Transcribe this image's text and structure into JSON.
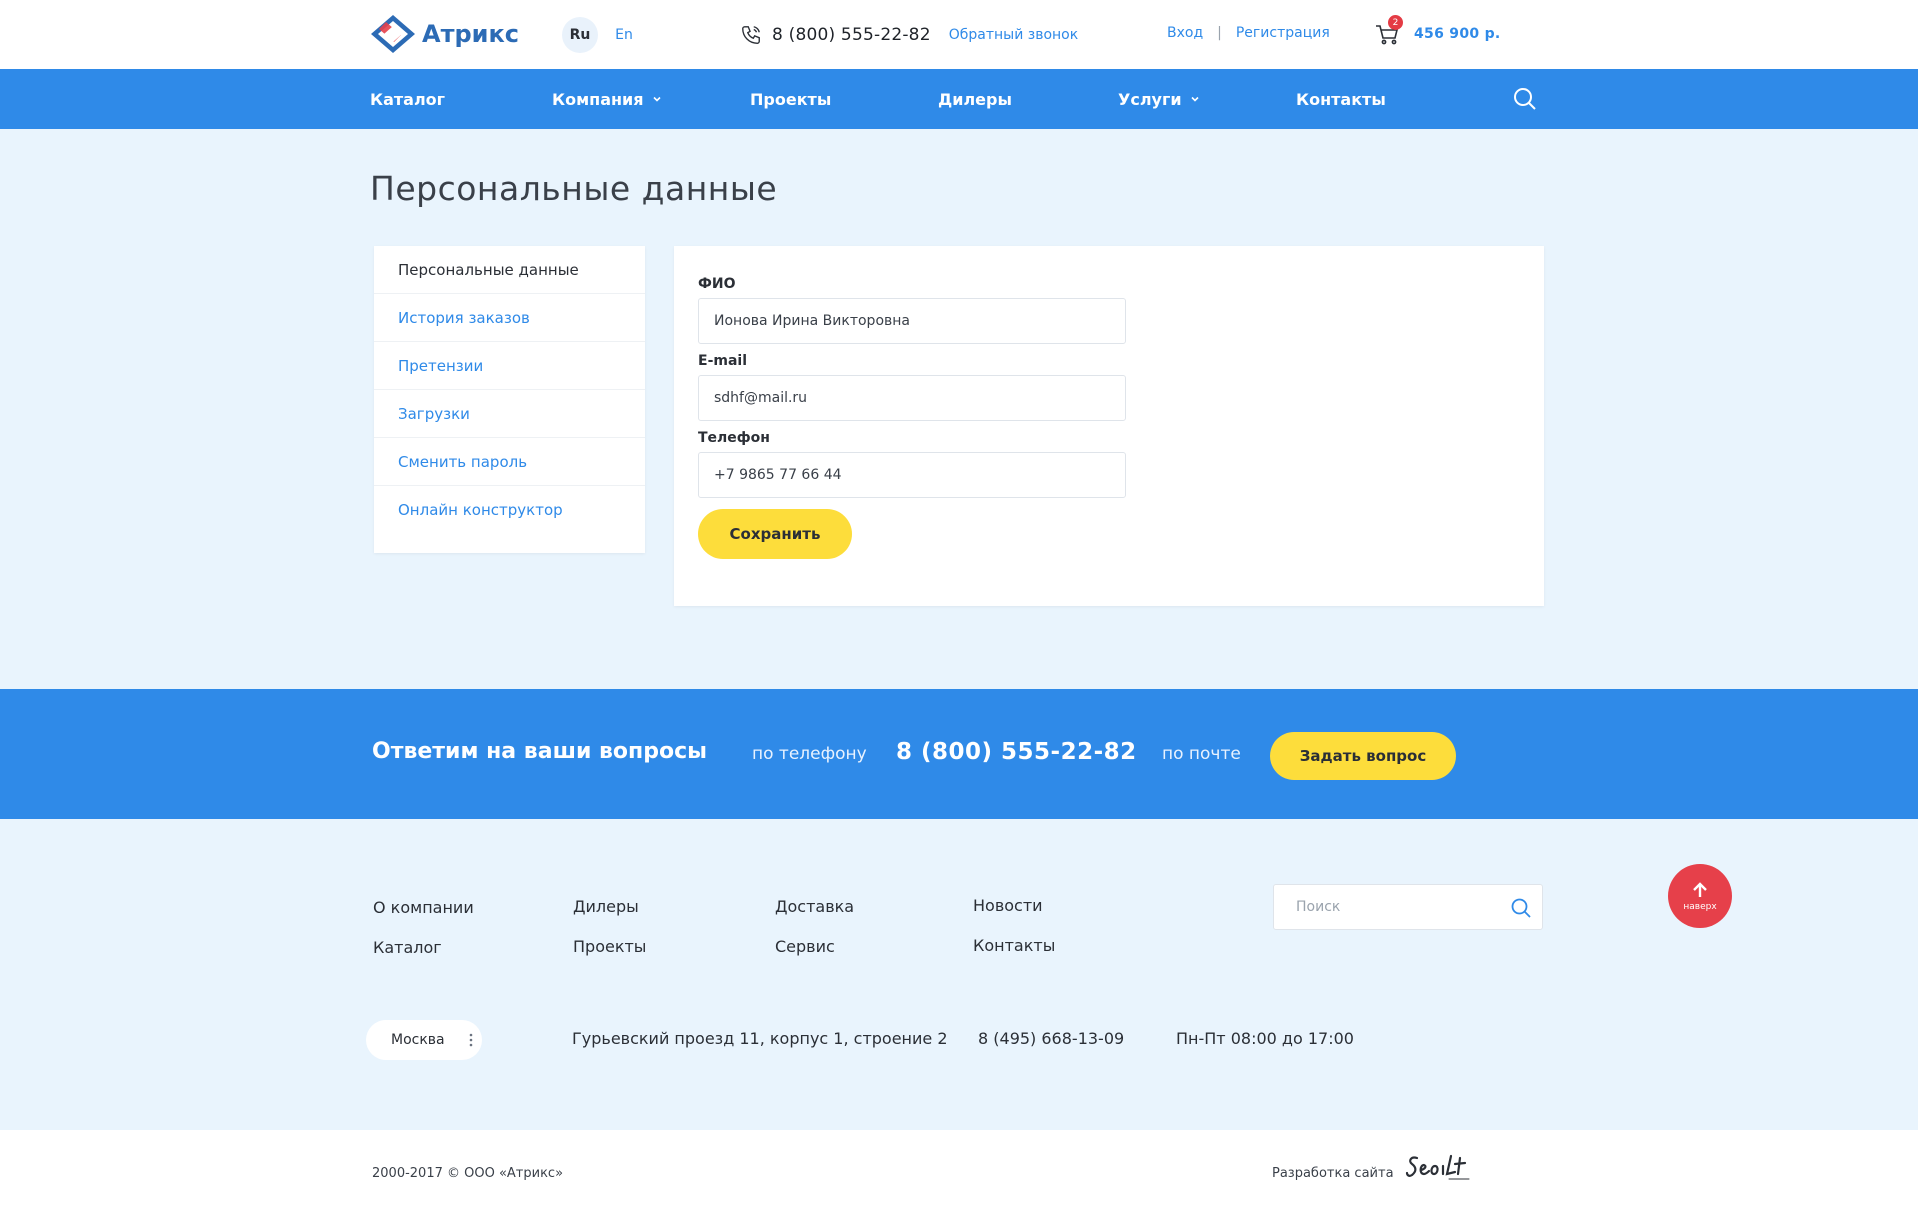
{
  "header": {
    "logo_text": "Атрикс",
    "lang_ru": "Ru",
    "lang_en": "En",
    "phone": "8 (800) 555-22-82",
    "callback": "Обратный звонок",
    "login": "Вход",
    "auth_separator": "|",
    "register": "Регистрация",
    "cart_count": "2",
    "cart_sum": "456 900 р."
  },
  "nav": {
    "items": [
      {
        "label": "Каталог"
      },
      {
        "label": "Компания"
      },
      {
        "label": "Проекты"
      },
      {
        "label": "Дилеры"
      },
      {
        "label": "Услуги"
      },
      {
        "label": "Контакты"
      }
    ]
  },
  "page": {
    "title": "Персональные данные"
  },
  "sidebar": {
    "items": [
      {
        "label": "Персональные данные"
      },
      {
        "label": "История заказов"
      },
      {
        "label": "Претензии"
      },
      {
        "label": "Загрузки"
      },
      {
        "label": "Сменить пароль"
      },
      {
        "label": "Онлайн конструктор"
      }
    ]
  },
  "form": {
    "fio_label": "ФИО",
    "fio_value": "Ионова Ирина Викторовна",
    "email_label": "E-mail",
    "email_value": "sdhf@mail.ru",
    "phone_label": "Телефон",
    "phone_value": "+7 9865 77 66 44",
    "save_label": "Сохранить"
  },
  "questions": {
    "title": "Ответим на ваши вопросы",
    "by_phone": "по телефону",
    "phone": "8 (800) 555-22-82",
    "by_mail": "по почте",
    "ask_label": "Задать вопрос"
  },
  "footer": {
    "links": [
      {
        "label": "О компании"
      },
      {
        "label": "Каталог"
      },
      {
        "label": "Дилеры"
      },
      {
        "label": "Проекты"
      },
      {
        "label": "Доставка"
      },
      {
        "label": "Сервис"
      },
      {
        "label": "Новости"
      },
      {
        "label": "Контакты"
      }
    ],
    "search_placeholder": "Поиск",
    "to_top": "наверх",
    "city": "Москва",
    "address": "Гурьевский проезд 11, корпус 1, строение 2",
    "phone": "8 (495) 668-13-09",
    "hours": "Пн-Пт 08:00 до 17:00",
    "copyright": "2000-2017 © ООО «Атрикс»",
    "developer_label": "Разработка сайта"
  },
  "colors": {
    "brand_blue": "#2f8ae8",
    "accent_yellow": "#fddd3b",
    "alert_red": "#e6404a",
    "page_bg": "#e9f4fd"
  },
  "icons": [
    "logo-icon",
    "phone-icon",
    "cart-icon",
    "chevron-down-icon",
    "search-icon",
    "arrow-up-icon",
    "more-vertical-icon",
    "developer-logo"
  ]
}
